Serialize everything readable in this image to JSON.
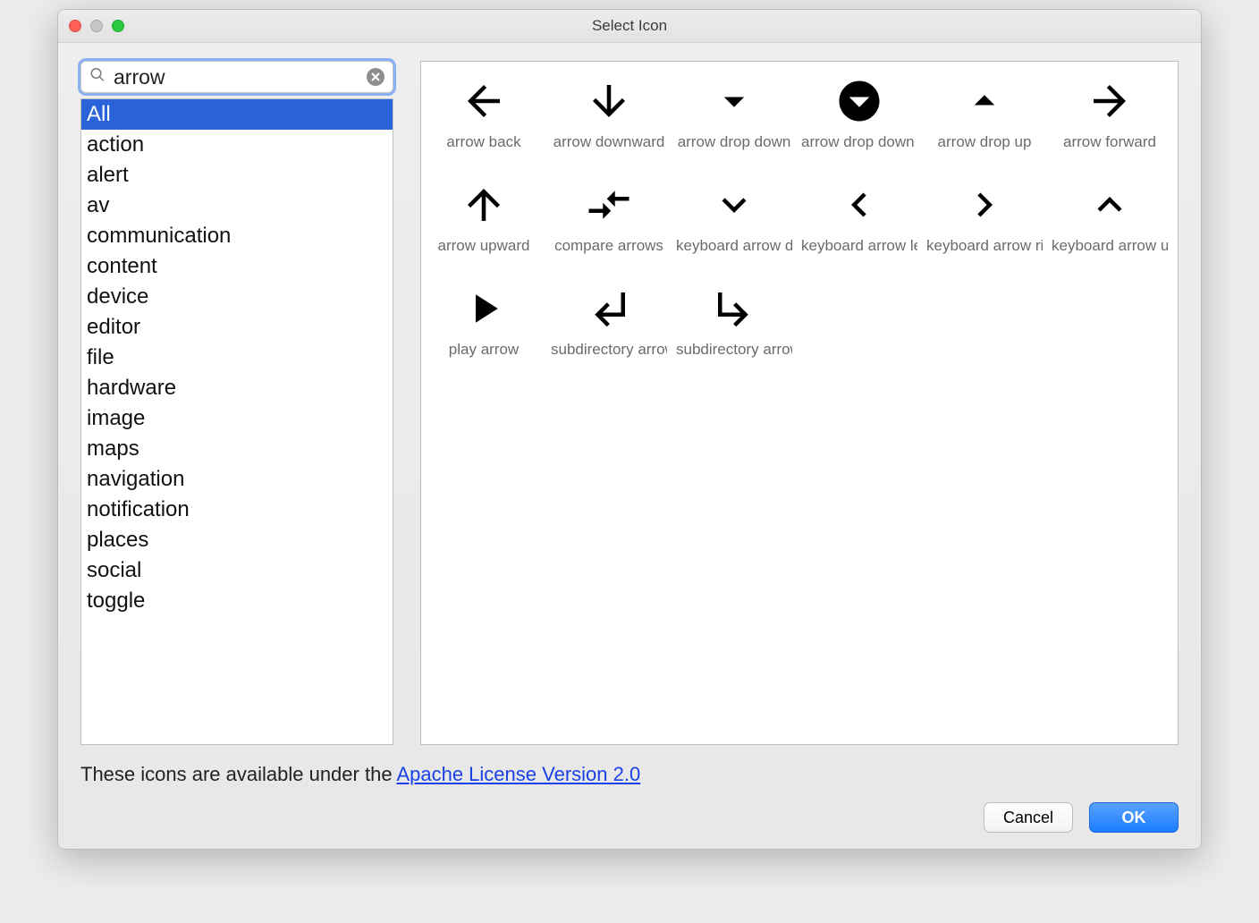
{
  "window": {
    "title": "Select Icon"
  },
  "search": {
    "value": "arrow"
  },
  "categories": {
    "selected_index": 0,
    "items": [
      "All",
      "action",
      "alert",
      "av",
      "communication",
      "content",
      "device",
      "editor",
      "file",
      "hardware",
      "image",
      "maps",
      "navigation",
      "notification",
      "places",
      "social",
      "toggle"
    ]
  },
  "icons": [
    {
      "label": "arrow back"
    },
    {
      "label": "arrow downward"
    },
    {
      "label": "arrow drop down"
    },
    {
      "label": "arrow drop down circle"
    },
    {
      "label": "arrow drop up"
    },
    {
      "label": "arrow forward"
    },
    {
      "label": "arrow upward"
    },
    {
      "label": "compare arrows"
    },
    {
      "label": "keyboard arrow down"
    },
    {
      "label": "keyboard arrow left"
    },
    {
      "label": "keyboard arrow right"
    },
    {
      "label": "keyboard arrow up"
    },
    {
      "label": "play arrow"
    },
    {
      "label": "subdirectory arrow left"
    },
    {
      "label": "subdirectory arrow right"
    }
  ],
  "license": {
    "prefix": "These icons are available under the ",
    "link_text": "Apache License Version 2.0"
  },
  "buttons": {
    "cancel": "Cancel",
    "ok": "OK"
  }
}
